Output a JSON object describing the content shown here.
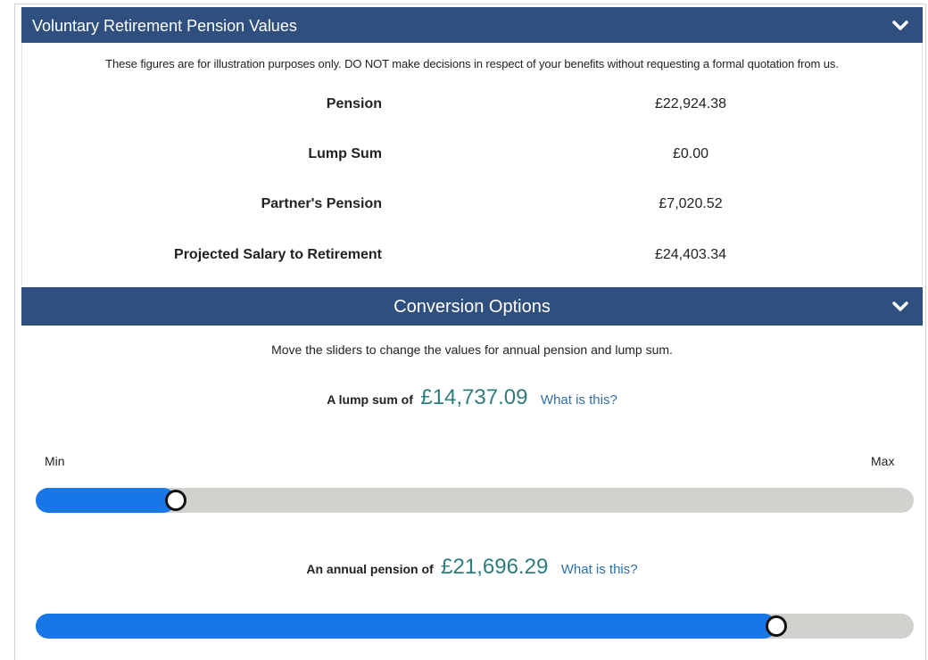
{
  "voluntary": {
    "title": "Voluntary Retirement Pension Values",
    "disclaimer": "These figures are for illustration purposes only. DO NOT make decisions in respect of your benefits without requesting a formal quotation from us.",
    "rows": [
      {
        "label": "Pension",
        "value": "£22,924.38"
      },
      {
        "label": "Lump Sum",
        "value": "£0.00"
      },
      {
        "label": "Partner's Pension",
        "value": "£7,020.52"
      },
      {
        "label": "Projected Salary to Retirement",
        "value": "£24,403.34"
      }
    ]
  },
  "conversion": {
    "title": "Conversion Options",
    "instruction": "Move the sliders to change the values for annual pension and lump sum.",
    "lump_sum": {
      "label": "A lump sum of",
      "amount": "£14,737.09",
      "help": "What is this?",
      "min_label": "Min",
      "max_label": "Max",
      "slider_fraction": 0.16
    },
    "annual_pension": {
      "label": "An annual pension of",
      "amount": "£21,696.29",
      "help": "What is this?",
      "slider_fraction": 0.843
    }
  },
  "colors": {
    "header_bg": "#2f4f7f",
    "slider_fill": "#1877e6",
    "slider_track": "#d3d1cd",
    "amount_text": "#2e7d7d",
    "link_text": "#2f6fa8"
  },
  "icons": {
    "collapse": "chevron-down-icon"
  }
}
